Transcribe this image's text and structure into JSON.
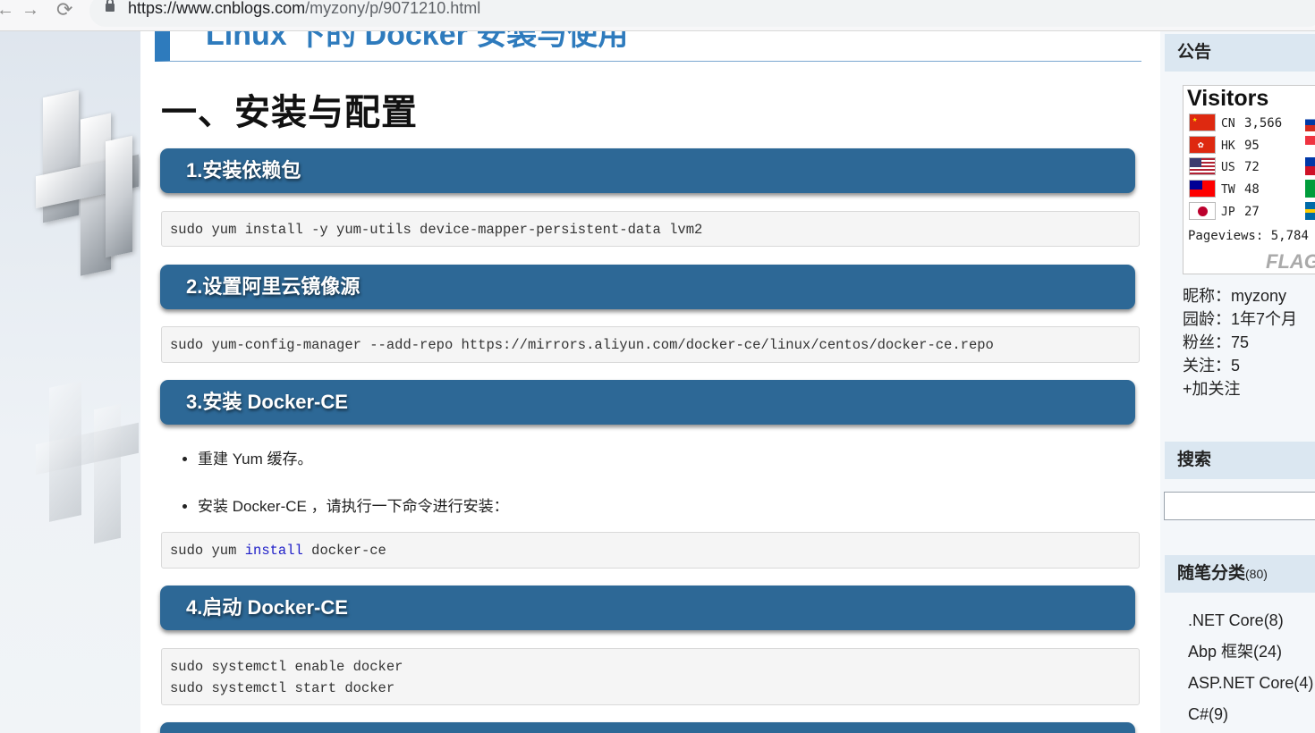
{
  "browser": {
    "url_scheme_host": "https://www.cnblogs.com",
    "url_path": "/myzony/p/9071210.html",
    "back_icon": "back-arrow-icon",
    "forward_icon": "forward-arrow-icon",
    "reload_icon": "reload-icon",
    "lock_icon": "lock-icon"
  },
  "article": {
    "post_title": "Linux 下的 Docker 安装与使用",
    "h1": "一、安装与配置",
    "sections": [
      {
        "heading": "1.安装依赖包",
        "code": [
          "sudo yum install -y yum-utils device-mapper-persistent-data lvm2"
        ]
      },
      {
        "heading": "2.设置阿里云镜像源",
        "code": [
          "sudo yum-config-manager --add-repo https://mirrors.aliyun.com/docker-ce/linux/centos/docker-ce.repo"
        ]
      },
      {
        "heading": "3.安装 Docker-CE",
        "bullets": [
          "重建 Yum 缓存。",
          "安装 Docker-CE ，请执行一下命令进行安装："
        ],
        "code_parts": [
          "sudo yum ",
          "install",
          " docker-ce"
        ]
      },
      {
        "heading": "4.启动 Docker-CE",
        "code": [
          "sudo systemctl enable docker",
          "sudo systemctl start docker"
        ]
      }
    ]
  },
  "sidebar": {
    "notice_title": "公告",
    "visitors": {
      "title": "Visitors",
      "rows": [
        {
          "code": "CN",
          "count": "3,566",
          "color": "#de2910"
        },
        {
          "code": "HK",
          "count": "95",
          "color": "#de2910"
        },
        {
          "code": "US",
          "count": "72",
          "color": "#3c3b6e"
        },
        {
          "code": "TW",
          "count": "48",
          "color": "#fe0000"
        },
        {
          "code": "JP",
          "count": "27",
          "color": "#bc002d"
        }
      ],
      "pageviews_label": "Pageviews:",
      "pageviews_value": "5,784",
      "logo_text": "FLAG counter"
    },
    "profile": {
      "nickname": "昵称：myzony",
      "age": "园龄：1年7个月",
      "fans": "粉丝：75",
      "follow": "关注：5",
      "add_follow": "+加关注"
    },
    "search_title": "搜索",
    "category_title": "随笔分类",
    "category_count": "(80)",
    "categories": [
      ".NET Core(8)",
      "Abp 框架(24)",
      "ASP.NET Core(4)",
      "C#(9)"
    ]
  }
}
